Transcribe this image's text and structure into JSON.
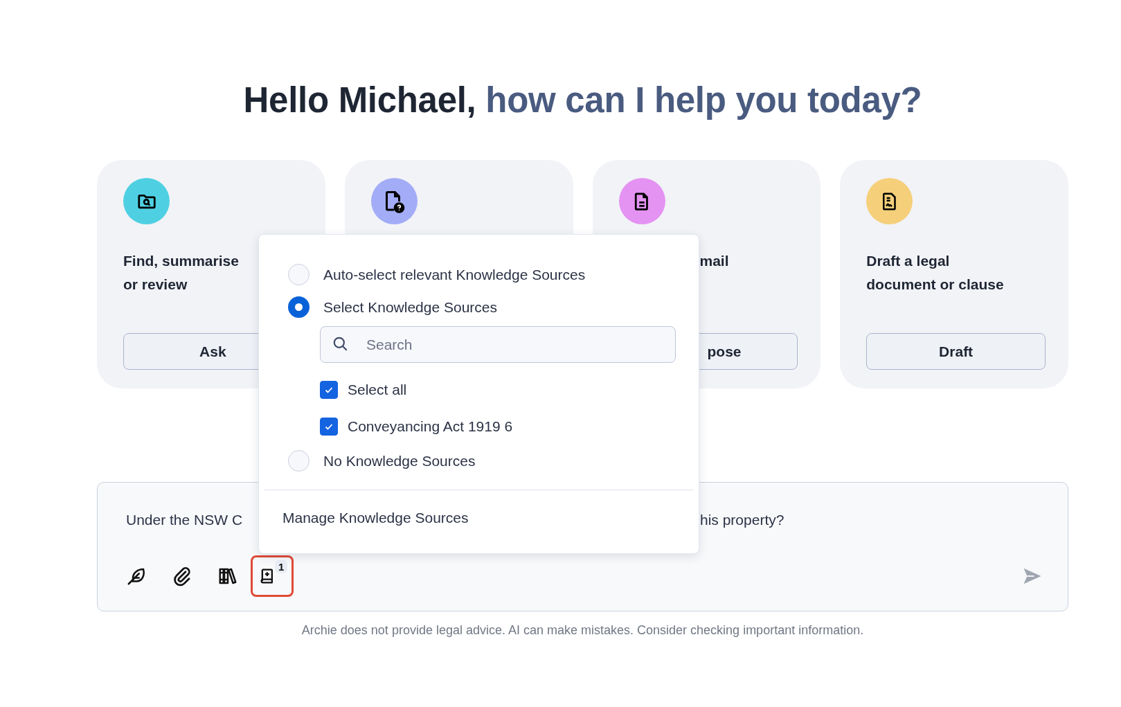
{
  "heading": {
    "greeting": "Hello Michael,",
    "question": "how can I help you today?"
  },
  "cards": [
    {
      "kind": "find",
      "color": "#4fd0e2",
      "title_lines": [
        "Find, summarise",
        "or review"
      ],
      "button": "Ask",
      "cut_left": false
    },
    {
      "kind": "question",
      "color": "#a3acf6"
    },
    {
      "kind": "document",
      "color": "#e493f2",
      "title_lines": [
        "mail"
      ],
      "button": "pose",
      "cut_left": true
    },
    {
      "kind": "signed",
      "color": "#f5cf7a",
      "title_lines": [
        "Draft a legal",
        "document or clause"
      ],
      "button": "Draft",
      "cut_left": false
    }
  ],
  "composer": {
    "value_left": "Under the NSW C",
    "value_right": "his property?",
    "knowledge_badge": "1",
    "knowledge_highlighted": true
  },
  "popup": {
    "items": [
      {
        "kind": "radio",
        "label": "Auto-select relevant Knowledge Sources",
        "selected": false
      },
      {
        "kind": "radio",
        "label": "Select Knowledge Sources",
        "selected": true
      },
      {
        "kind": "search",
        "placeholder": "Search"
      },
      {
        "kind": "checkbox",
        "label": "Select all",
        "checked": true
      },
      {
        "kind": "checkbox",
        "label": "Conveyancing Act 1919 6",
        "checked": true
      },
      {
        "kind": "radio",
        "label": "No Knowledge Sources",
        "selected": false
      }
    ],
    "footer_link": "Manage Knowledge Sources"
  },
  "disclaimer": "Archie does not provide legal advice. AI can make mistakes. Consider checking important information."
}
